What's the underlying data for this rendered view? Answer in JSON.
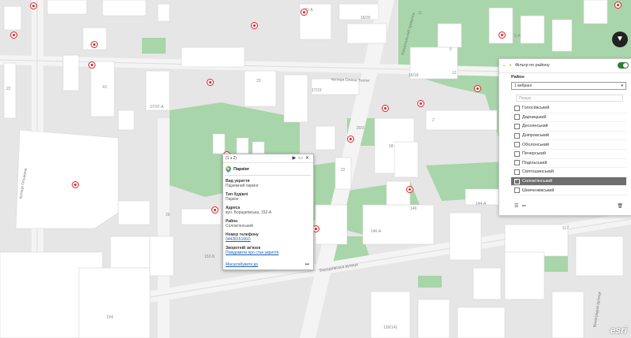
{
  "map": {
    "streets": {
      "olesia_telihy": "вулиця Олени Теліги",
      "borshchahivska": "Борщагівська вулиця",
      "vinohradna": "Виноградна вулиця",
      "hetmana": "вулиця Гетьмана",
      "almatynskyi": "Алматинський провулок"
    },
    "building_labels": [
      "22-А",
      "18/20",
      "5-А",
      "5",
      "41",
      "37/37-А",
      "23",
      "17/19",
      "12",
      "16/18",
      "22",
      "2",
      "20/2",
      "18",
      "146",
      "144-А",
      "146-А",
      "117",
      "152-Б",
      "154",
      "139/141",
      "22",
      "20",
      "11"
    ],
    "attribution": "esri"
  },
  "filter_button": {
    "icon": "filter-icon"
  },
  "popup": {
    "pager": "(1 з 2)",
    "controls": [
      "▶",
      "▭",
      "✕"
    ],
    "title": "Паркінг",
    "fields": [
      {
        "key": "Вид укриття",
        "value": "Підземний паркінг"
      },
      {
        "key": "Тип будівлі",
        "value": "Паркінг"
      },
      {
        "key": "Адреса",
        "value": "вул. Борщагівська, 152-А"
      },
      {
        "key": "Район",
        "value": "Солом'янський"
      },
      {
        "key": "Номер телефону",
        "value": "0442815166О"
      },
      {
        "key": "Зворотній зв'язок",
        "value": "Повідомити про стан укриття"
      }
    ],
    "zoom_link": "Масштабувати до",
    "more": "•••"
  },
  "panel": {
    "title": "Фільтр по району",
    "toggle_on": true,
    "field_label": "Район",
    "select_value": "1 вибрані",
    "search_placeholder": "Пошук",
    "options": [
      {
        "label": "Голосіївський",
        "checked": false
      },
      {
        "label": "Дарницький",
        "checked": false
      },
      {
        "label": "Деснянський",
        "checked": false
      },
      {
        "label": "Дніпровський",
        "checked": false
      },
      {
        "label": "Оболонський",
        "checked": false
      },
      {
        "label": "Печерський",
        "checked": false
      },
      {
        "label": "Подільський",
        "checked": false
      },
      {
        "label": "Святошинський",
        "checked": false
      },
      {
        "label": "Солом'янський",
        "checked": true
      },
      {
        "label": "Шевченківський",
        "checked": false
      }
    ]
  },
  "colors": {
    "park": "#a8d5a9",
    "building": "#ffffff",
    "road": "#f6f6f6",
    "marker": "#dd2222",
    "accent": "#2e7d32"
  }
}
